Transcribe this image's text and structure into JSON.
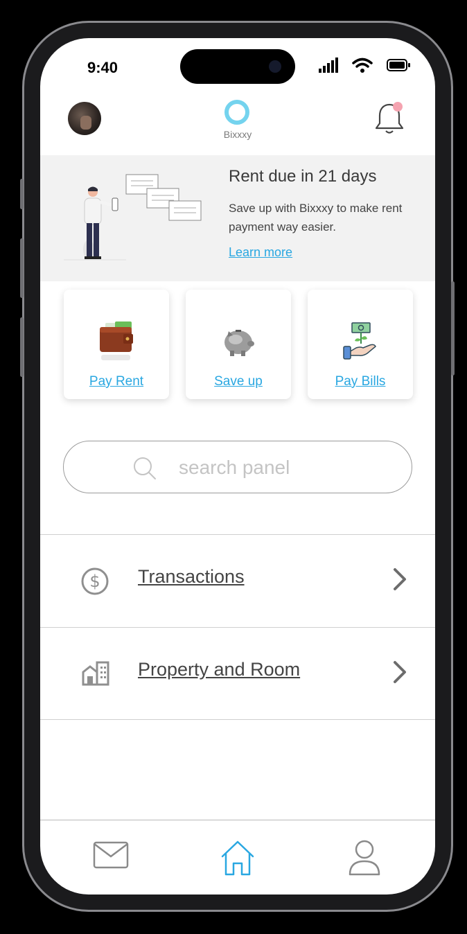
{
  "status": {
    "time": "9:40"
  },
  "header": {
    "app_name": "Bixxxy"
  },
  "banner": {
    "title": "Rent due in 21 days",
    "text": "Save up with Bixxxy to make rent payment way easier.",
    "link": "Learn more"
  },
  "actions": [
    {
      "label": "Pay Rent",
      "icon": "wallet-icon"
    },
    {
      "label": "Save up",
      "icon": "piggy-bank-icon"
    },
    {
      "label": "Pay Bills",
      "icon": "money-hand-icon"
    }
  ],
  "search": {
    "placeholder": "search panel",
    "value": ""
  },
  "menu": [
    {
      "label": "Transactions",
      "icon": "dollar-circle-icon"
    },
    {
      "label": "Property and Room",
      "icon": "building-icon"
    }
  ],
  "tabs": [
    {
      "name": "mail",
      "icon": "mail-icon",
      "active": false
    },
    {
      "name": "home",
      "icon": "home-icon",
      "active": true
    },
    {
      "name": "profile",
      "icon": "user-icon",
      "active": false
    }
  ],
  "colors": {
    "accent": "#29a7e1",
    "logo": "#74d3ee",
    "notification": "#f5a3b0",
    "banner_bg": "#f2f2f2"
  }
}
